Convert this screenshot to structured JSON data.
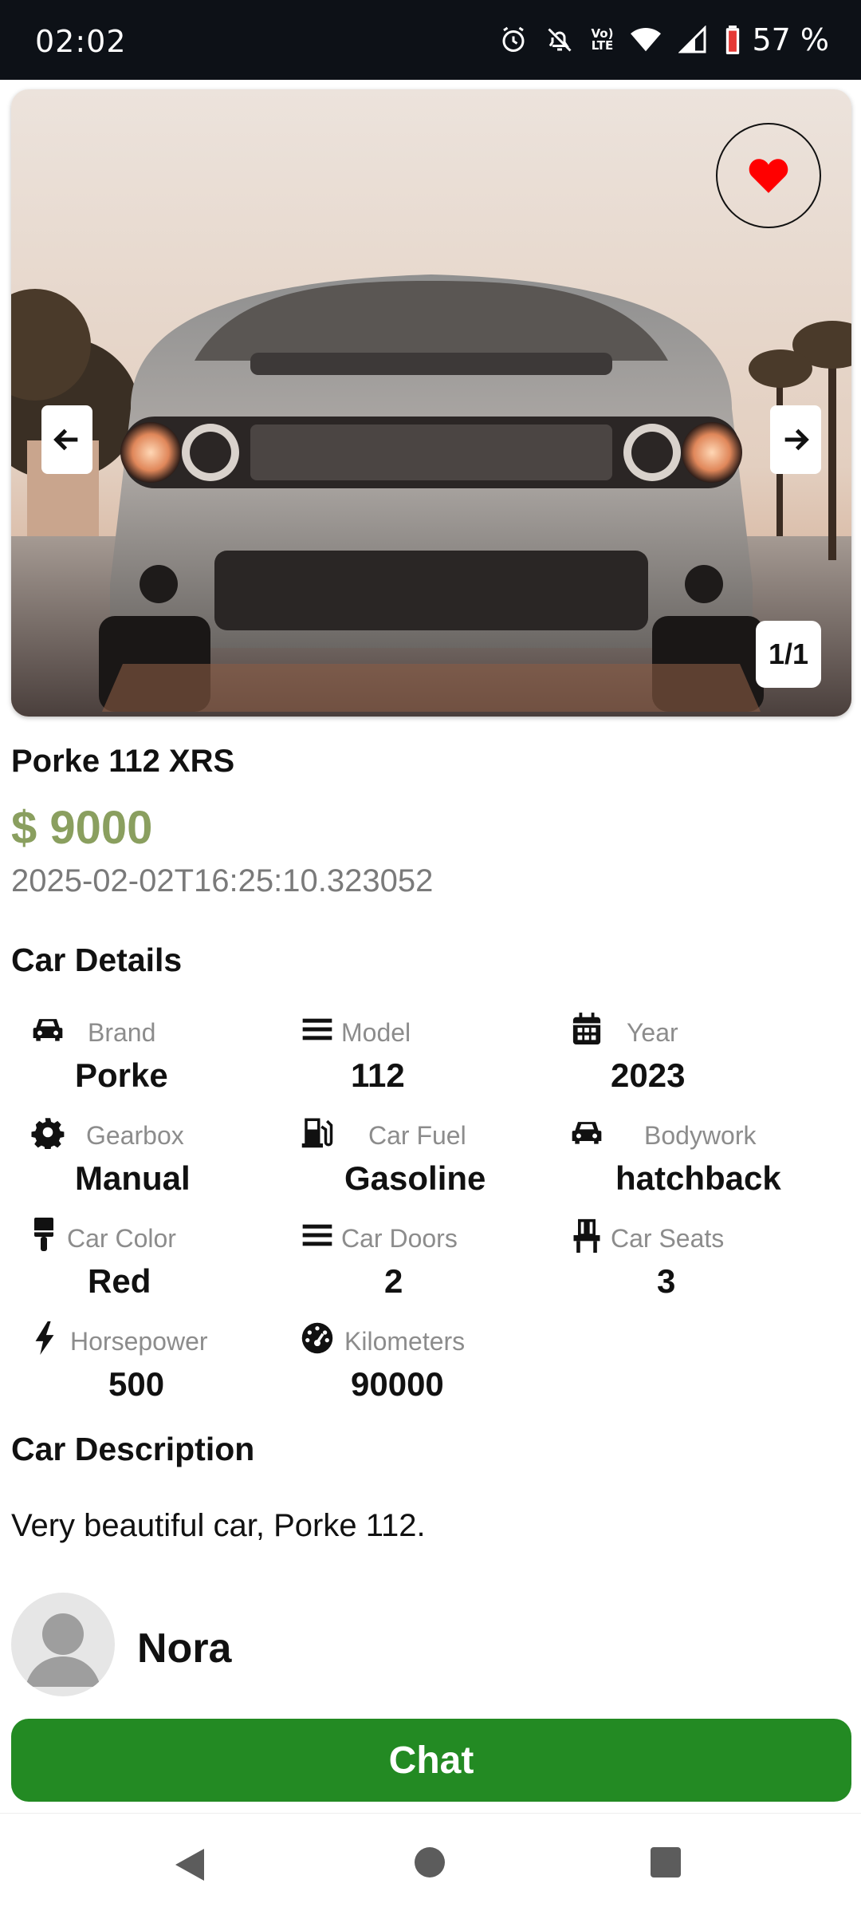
{
  "status_bar": {
    "time": "02:02",
    "battery": "57 %",
    "volte_top": "Vo)",
    "volte_bottom": "LTE",
    "icons": [
      "alarm-icon",
      "bell-off-icon",
      "volte-icon",
      "wifi-icon",
      "signal-icon",
      "battery-icon"
    ]
  },
  "gallery": {
    "counter": "1/1",
    "favorite_icon": "heart-icon",
    "favorite_color": "#ff0000",
    "prev_icon": "arrow-left-icon",
    "next_icon": "arrow-right-icon"
  },
  "car": {
    "title": "Porke 112 XRS",
    "price": "$ 9000",
    "posted": "2025-02-02T16:25:10.323052"
  },
  "details_section": {
    "title": "Car Details",
    "items": [
      {
        "icon": "car-icon",
        "label": "Brand",
        "value": "Porke"
      },
      {
        "icon": "menu-icon",
        "label": "Model",
        "value": "112"
      },
      {
        "icon": "calendar-icon",
        "label": "Year",
        "value": "2023"
      },
      {
        "icon": "gear-icon",
        "label": "Gearbox",
        "value": "Manual"
      },
      {
        "icon": "fuel-pump-icon",
        "label": "Car Fuel",
        "value": "Gasoline"
      },
      {
        "icon": "car-icon",
        "label": "Bodywork",
        "value": "hatchback"
      },
      {
        "icon": "paint-brush-icon",
        "label": "Car Color",
        "value": "Red"
      },
      {
        "icon": "menu-icon",
        "label": "Car Doors",
        "value": "2"
      },
      {
        "icon": "chair-icon",
        "label": "Car Seats",
        "value": "3"
      },
      {
        "icon": "bolt-icon",
        "label": "Horsepower",
        "value": "500"
      },
      {
        "icon": "gauge-icon",
        "label": "Kilometers",
        "value": "90000"
      }
    ]
  },
  "description_section": {
    "title": "Car Description",
    "text": "Very beautiful car, Porke 112."
  },
  "seller": {
    "name": "Nora",
    "avatar_icon": "user-avatar-icon"
  },
  "actions": {
    "chat_label": "Chat",
    "chat_color": "#238a23",
    "price_color": "#8a9f5f"
  },
  "nav_bar": {
    "icons": [
      "back-icon",
      "home-icon",
      "recents-icon"
    ]
  }
}
